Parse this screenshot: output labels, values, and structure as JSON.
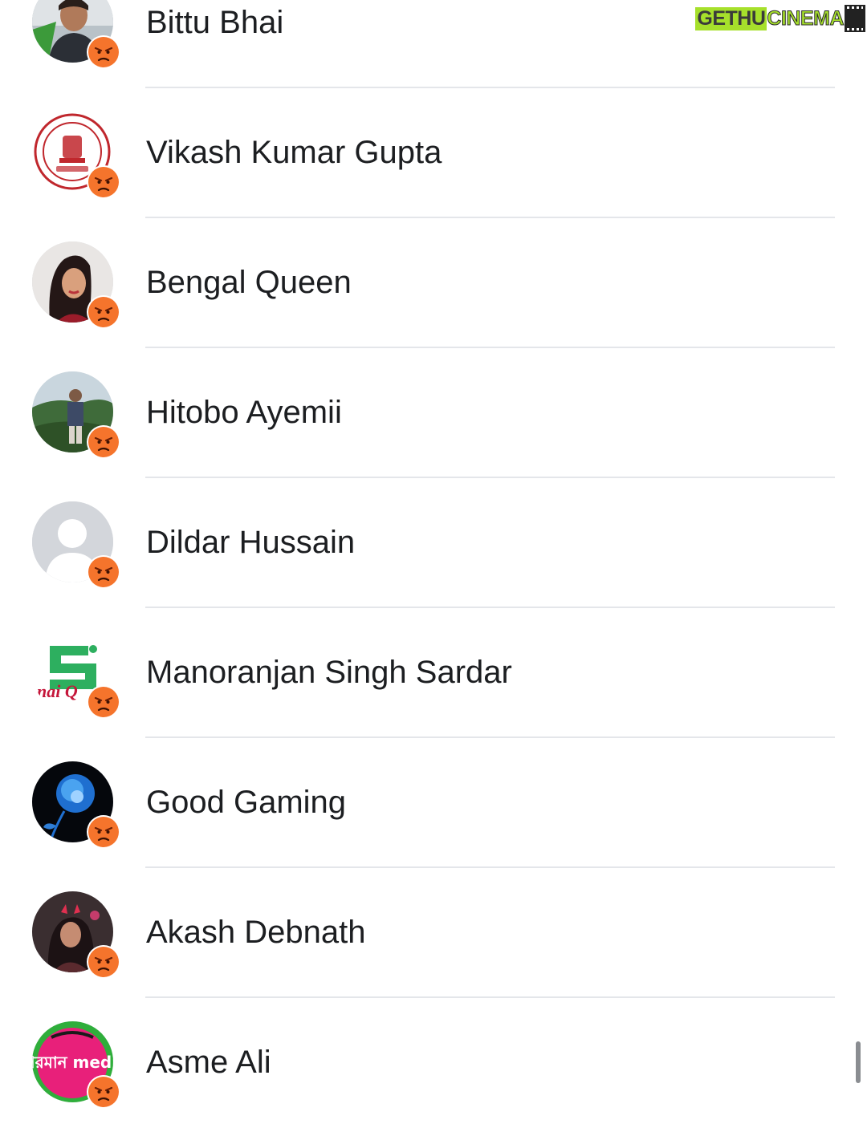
{
  "watermark": {
    "part1": "GETHU",
    "part2": "CINEMA"
  },
  "reaction_icon": "angry-face-icon",
  "colors": {
    "reaction": "#f5742c",
    "divider": "#e4e6ea",
    "text": "#1c1e21",
    "watermark_green": "#a6e02b"
  },
  "people": [
    {
      "name": "Bittu Bhai",
      "avatar": "photo"
    },
    {
      "name": "Vikash Kumar Gupta",
      "avatar": "emblem-seal"
    },
    {
      "name": "Bengal Queen",
      "avatar": "photo"
    },
    {
      "name": "Hitobo Ayemii",
      "avatar": "photo"
    },
    {
      "name": "Dildar Hussain",
      "avatar": "default-silhouette"
    },
    {
      "name": "Manoranjan Singh Sardar",
      "avatar": "logo"
    },
    {
      "name": "Good Gaming",
      "avatar": "blue-rose"
    },
    {
      "name": "Akash Debnath",
      "avatar": "photo"
    },
    {
      "name": "Asme Ali",
      "avatar": "logo"
    }
  ],
  "avatar_logo_texts": {
    "asme_ali": "আরমান media",
    "manoranjan": "nai Q"
  }
}
